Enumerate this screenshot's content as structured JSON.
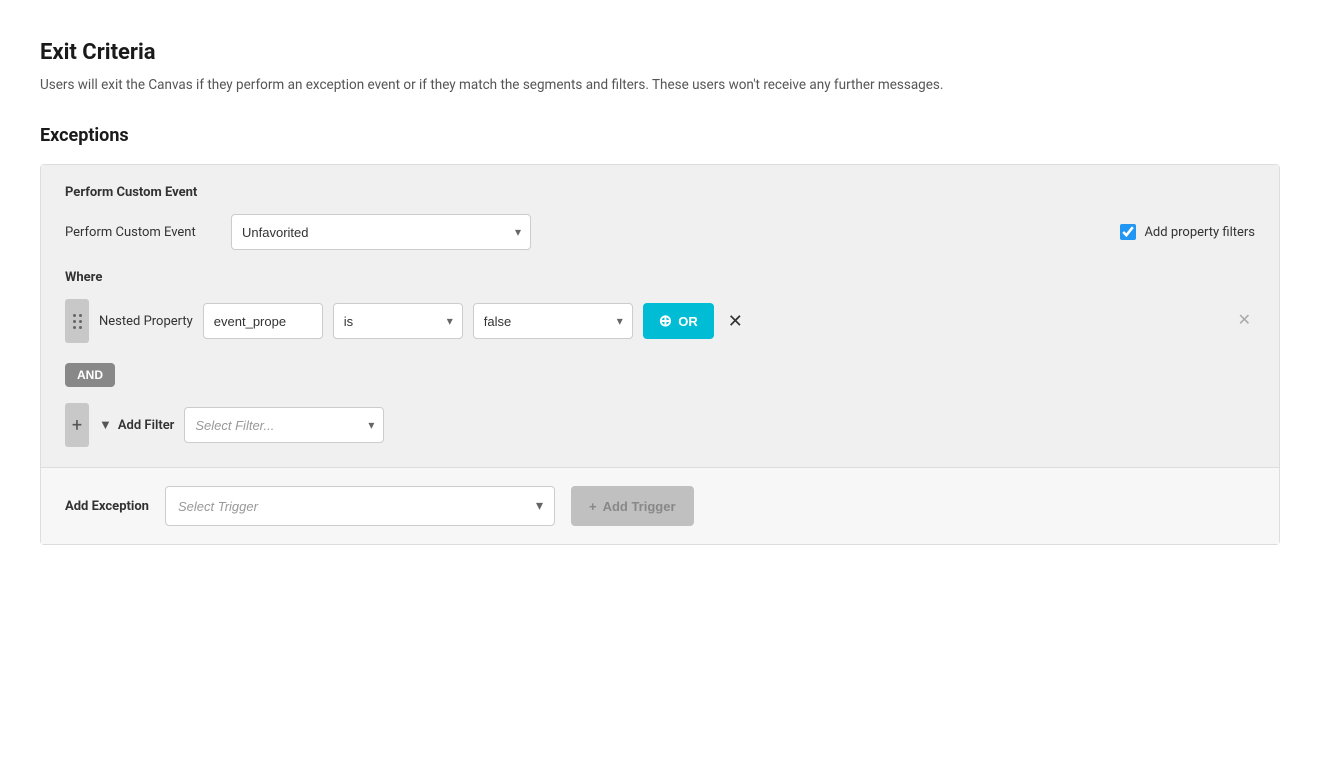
{
  "page": {
    "title": "Exit Criteria",
    "description": "Users will exit the Canvas if they perform an exception event or if they match the segments and filters. These users won't receive any further messages.",
    "exceptions_title": "Exceptions"
  },
  "exception_block": {
    "header": "Perform Custom Event",
    "perform_label": "Perform Custom Event",
    "event_value": "Unfavorited",
    "add_property_filters_label": "Add property filters",
    "where_label": "Where",
    "nested_property_label": "Nested Property",
    "event_prop_value": "event_prope",
    "is_value": "is",
    "false_value": "false",
    "or_button_label": "OR",
    "and_button_label": "AND",
    "add_filter_label": "Add Filter",
    "select_filter_placeholder": "Select Filter...",
    "add_exception_label": "Add Exception",
    "select_trigger_placeholder": "Select Trigger",
    "add_trigger_label": "Add Trigger"
  },
  "icons": {
    "chevron_down": "▾",
    "plus": "+",
    "times": "✕",
    "circle_plus": "⊕",
    "filter": "⊟",
    "drag": "⋮⋮"
  },
  "colors": {
    "or_button_bg": "#00bcd4",
    "and_button_bg": "#888888",
    "add_trigger_bg": "#c0c0c0",
    "checkbox_color": "#2196F3"
  }
}
